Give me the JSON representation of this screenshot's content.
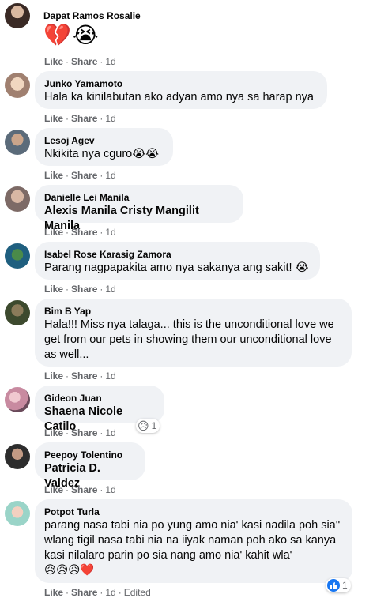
{
  "actions": {
    "like": "Like",
    "share": "Share",
    "dot": "·",
    "edited": "Edited"
  },
  "comments": [
    {
      "name": "Dapat Ramos Rosalie",
      "text": "💔😭",
      "time": "1d"
    },
    {
      "name": "Junko Yamamoto",
      "text": "Hala ka kinilabutan ako adyan amo nya sa harap nya",
      "time": "1d"
    },
    {
      "name": "Lesoj Agev",
      "text": "Nkikita nya cguro😭😭",
      "time": "1d"
    },
    {
      "name": "Danielle Lei Manila",
      "text": "Alexis Manila Cristy Mangilit Manila",
      "time": "1d"
    },
    {
      "name": "Isabel Rose Karasig Zamora",
      "text": "Parang nagpapakita amo nya sakanya ang sakit! 😭",
      "time": "1d"
    },
    {
      "name": "Bim B Yap",
      "text": "Hala!!! Miss nya talaga... this is the unconditional love we get from our pets in showing them our unconditional love as well...",
      "time": "1d"
    },
    {
      "name": "Gideon Juan",
      "text": "Shaena Nicole Catilo",
      "time": "1d",
      "reaction_count": "1",
      "reaction_emoji": "😥"
    },
    {
      "name": "Peepoy Tolentino",
      "text": "Patricia D. Valdez",
      "time": "1d"
    },
    {
      "name": "Potpot Turla",
      "text": "parang nasa tabi nia po yung amo nia' kasi nadila poh sia'' wlang tigil nasa tabi nia na iiyak naman poh ako sa kanya kasi nilalaro parin po sia nang amo nia' kahit wla'",
      "text_emoji": "😥😥😥❤️",
      "time": "1d",
      "reaction_count": "1"
    }
  ]
}
